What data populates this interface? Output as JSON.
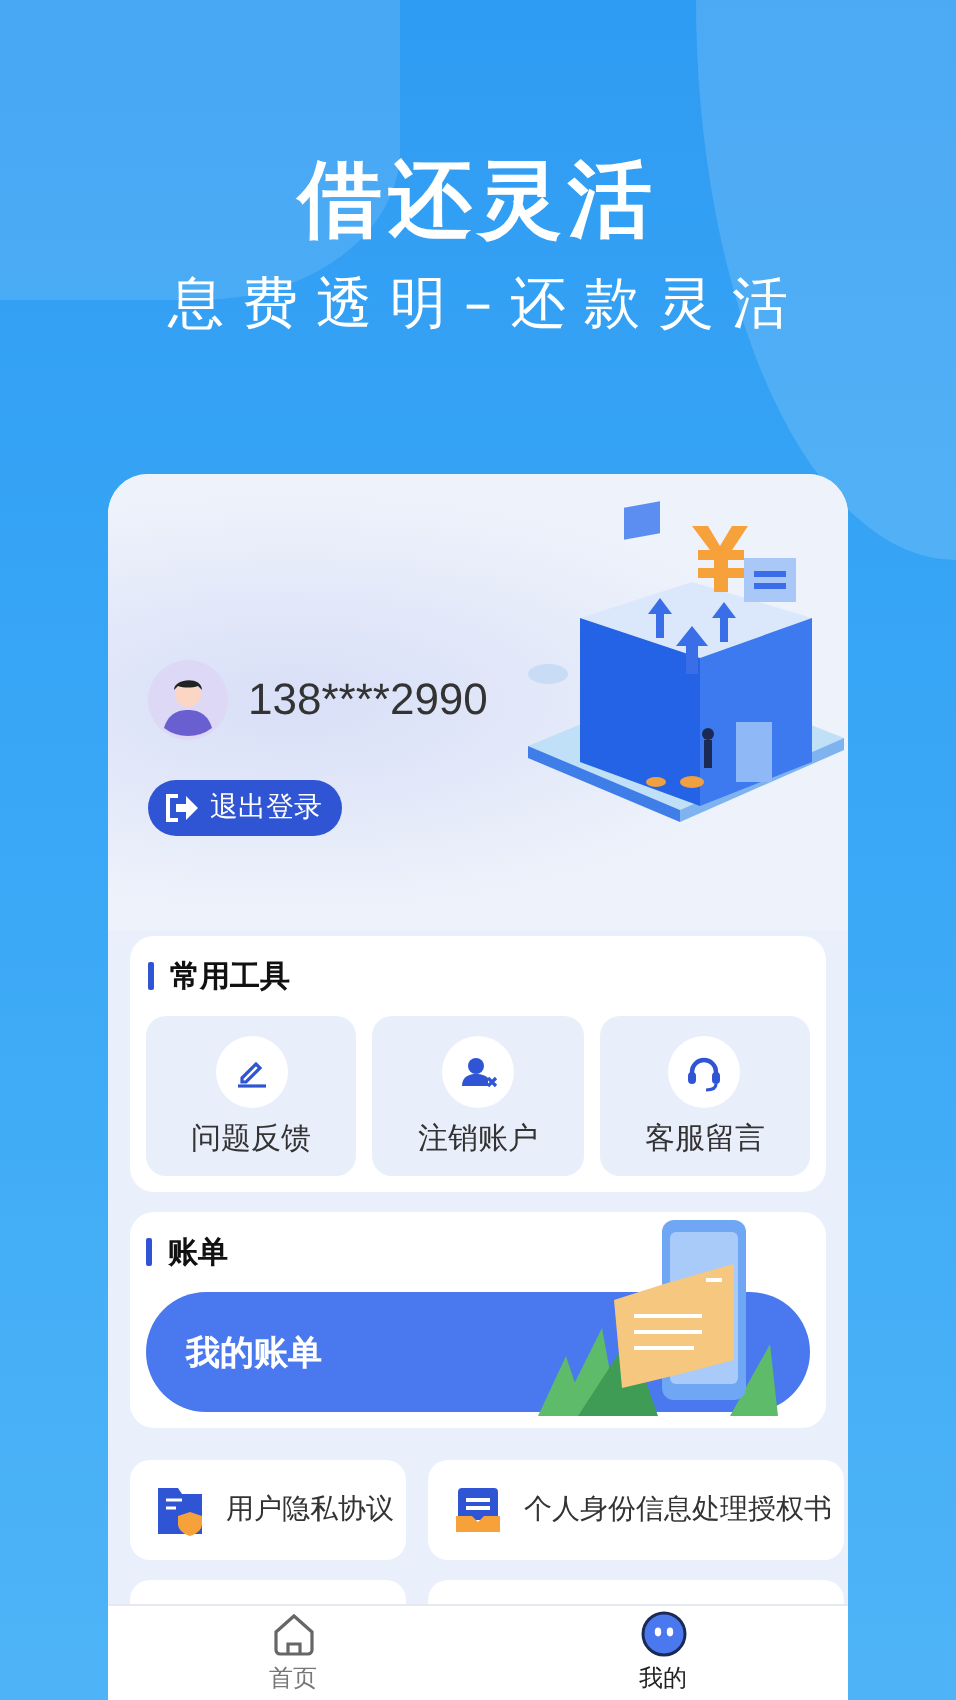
{
  "hero": {
    "title": "借还灵活",
    "subtitle": "息费透明–还款灵活"
  },
  "profile": {
    "phone": "138****2990",
    "logout": "退出登录"
  },
  "tools": {
    "title": "常用工具",
    "items": [
      {
        "label": "问题反馈",
        "kind": "feedback"
      },
      {
        "label": "注销账户",
        "kind": "cancel"
      },
      {
        "label": "客服留言",
        "kind": "service"
      }
    ]
  },
  "bill": {
    "title": "账单",
    "banner": "我的账单"
  },
  "links": [
    {
      "label": "用户隐私协议",
      "kind": "privacy"
    },
    {
      "label": "个人身份信息处理授权书",
      "kind": "auth"
    }
  ],
  "tabs": [
    {
      "label": "首页",
      "kind": "home",
      "selected": false
    },
    {
      "label": "我的",
      "kind": "mine",
      "selected": true
    }
  ]
}
